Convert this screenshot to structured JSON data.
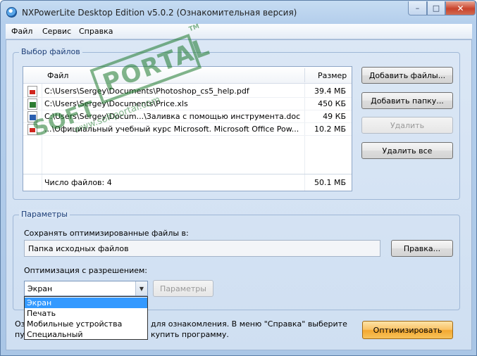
{
  "window": {
    "title": "NXPowerLite Desktop Edition v5.0.2  (Ознакомительная версия)",
    "controls": {
      "minimize": "–",
      "maximize": "□",
      "close": "✕"
    }
  },
  "menu": {
    "items": [
      "Файл",
      "Сервис",
      "Справка"
    ]
  },
  "file_group": {
    "title": "Выбор файлов",
    "columns": {
      "file": "Файл",
      "size": "Размер"
    },
    "files": [
      {
        "icon": "pdf-file-icon",
        "name": "C:\\Users\\Sergey\\Documents\\Photoshop_cs5_help.pdf",
        "size": "39.4 МБ"
      },
      {
        "icon": "excel-file-icon",
        "name": "C:\\Users\\Sergey\\Documents\\Price.xls",
        "size": "450 КБ"
      },
      {
        "icon": "word-file-icon",
        "name": "C:\\Users\\Sergey\\Docum...\\Заливка с помощью инструмента.doc",
        "size": "49 КБ"
      },
      {
        "icon": "pdf-file-icon",
        "name": "...\\Официальный учебный курс Microsoft. Microsoft Office Pow...",
        "size": "10.2 МБ"
      }
    ],
    "footer": {
      "count_label": "Число файлов: 4",
      "total_size": "50.1 МБ"
    },
    "buttons": {
      "add_files": "Добавить файлы...",
      "add_folder": "Добавить папку...",
      "remove": "Удалить",
      "remove_all": "Удалить все"
    }
  },
  "params_group": {
    "title": "Параметры",
    "save_label": "Сохранять оптимизированные файлы в:",
    "save_value": "Папка исходных файлов",
    "edit_button": "Правка...",
    "resolution_label": "Оптимизация с разрешением:",
    "resolution_selected": "Экран",
    "resolution_options": [
      "Экран",
      "Печать",
      "Мобильные устройства",
      "Специальный"
    ],
    "params_button": "Параметры"
  },
  "trial_notice": {
    "line1_left": "Оз",
    "line1_right": "для ознакомления.  В меню \"Справка\" выберите",
    "line2_left": "пу",
    "line2_right": "купить программу."
  },
  "optimize_button": "Оптимизировать",
  "watermark": {
    "text": "PORTAL",
    "trademark": "TM",
    "soft": "SOFT",
    "url": "www.softportal.com"
  }
}
